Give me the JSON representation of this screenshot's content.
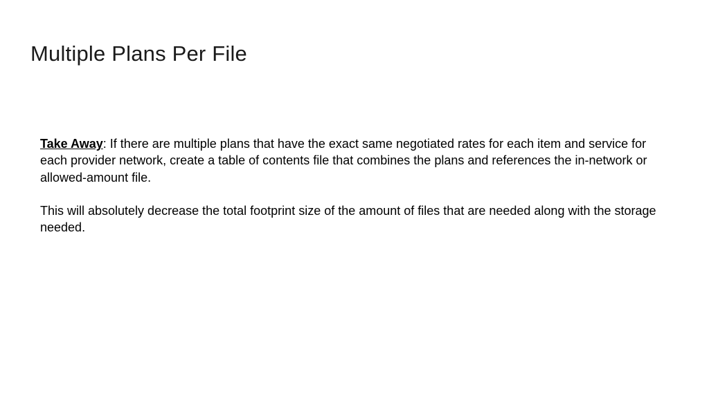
{
  "slide": {
    "title": "Multiple Plans Per File",
    "takeaway_label": "Take Away",
    "takeaway_text": ": If there are multiple plans that have the exact same negotiated rates for each item and service for each provider network, create a table of contents file that combines the plans and references the in-network or allowed-amount file.",
    "followup_text": "This will absolutely decrease the total footprint size of the amount of files that are needed along with the storage needed."
  }
}
